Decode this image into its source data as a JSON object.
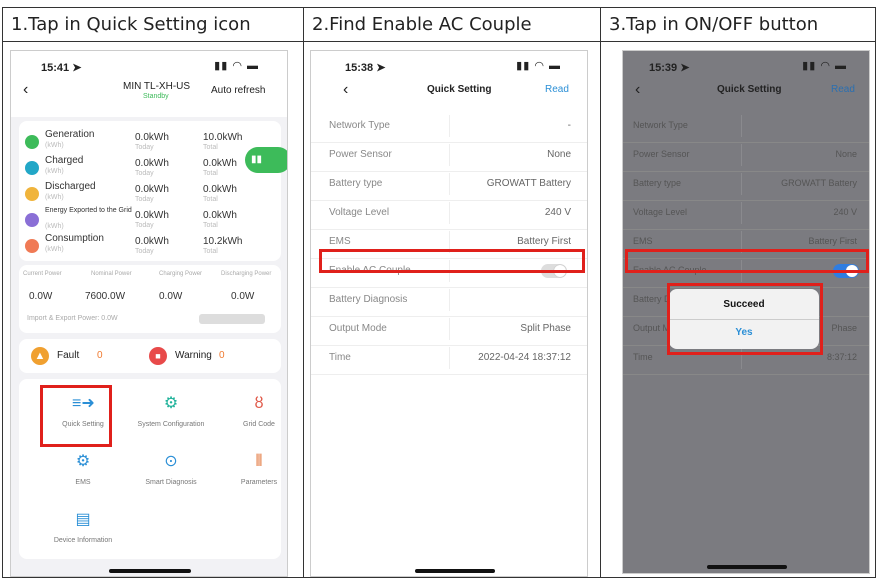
{
  "headers": [
    "1.Tap in Quick Setting icon",
    "2.Find Enable AC Couple",
    "3.Tap in ON/OFF button"
  ],
  "status_icons": "signal-wifi-battery",
  "phone1": {
    "time": "15:41",
    "device": "MIN TL-XH-US",
    "status": "Standby",
    "auto_refresh": "Auto refresh",
    "energy_rows": [
      {
        "label": "Generation",
        "unit": "(kWh)",
        "today": "0.0kWh",
        "today_sub": "Today",
        "total": "10.0kWh",
        "total_sub": "Total",
        "color": "#3dbb5a"
      },
      {
        "label": "Charged",
        "unit": "(kWh)",
        "today": "0.0kWh",
        "today_sub": "Today",
        "total": "0.0kWh",
        "total_sub": "Total",
        "color": "#22a7c7"
      },
      {
        "label": "Discharged",
        "unit": "(kWh)",
        "today": "0.0kWh",
        "today_sub": "Today",
        "total": "0.0kWh",
        "total_sub": "Total",
        "color": "#f0b43c"
      },
      {
        "label": "Energy Exported to the Grid",
        "unit": "(kWh)",
        "today": "0.0kWh",
        "today_sub": "Today",
        "total": "0.0kWh",
        "total_sub": "Total",
        "color": "#8a6fd6"
      },
      {
        "label": "Consumption",
        "unit": "(kWh)",
        "today": "0.0kWh",
        "today_sub": "Today",
        "total": "10.2kWh",
        "total_sub": "Total",
        "color": "#f07a55"
      }
    ],
    "power_labels": [
      "Current Power",
      "Nominal Power",
      "Charging Power",
      "Discharging Power"
    ],
    "power_values": [
      "0.0W",
      "7600.0W",
      "0.0W",
      "0.0W"
    ],
    "import_export": "Import & Export Power: 0.0W",
    "fault_label": "Fault",
    "fault_count": "0",
    "warning_label": "Warning",
    "warning_count": "0",
    "grid_items": [
      {
        "label": "Quick Setting",
        "icon": "quick-setting-icon",
        "glyph": "≡➜",
        "color": "#2b8fd6"
      },
      {
        "label": "System Configuration",
        "icon": "system-configuration-icon",
        "glyph": "⚙",
        "color": "#1fb29a"
      },
      {
        "label": "Grid Code",
        "icon": "grid-code-icon",
        "glyph": "ȣ",
        "color": "#e05a4a"
      },
      {
        "label": "EMS",
        "icon": "ems-icon",
        "glyph": "⚙",
        "color": "#2b8fd6"
      },
      {
        "label": "Smart Diagnosis",
        "icon": "smart-diagnosis-icon",
        "glyph": "⊙",
        "color": "#2b8fd6"
      },
      {
        "label": "Parameters",
        "icon": "parameters-icon",
        "glyph": "⫴",
        "color": "#e06a2a"
      },
      {
        "label": "Device Information",
        "icon": "device-information-icon",
        "glyph": "▤",
        "color": "#2b8fd6"
      }
    ]
  },
  "phone2": {
    "time": "15:38",
    "title": "Quick Setting",
    "read": "Read",
    "rows": [
      {
        "label": "Network Type",
        "value": "-"
      },
      {
        "label": "Power Sensor",
        "value": "None"
      },
      {
        "label": "Battery type",
        "value": "GROWATT Battery"
      },
      {
        "label": "Voltage Level",
        "value": "240 V"
      },
      {
        "label": "EMS",
        "value": "Battery First"
      },
      {
        "label": "Enable AC Couple",
        "value": ""
      },
      {
        "label": "Battery Diagnosis",
        "value": ""
      },
      {
        "label": "Output Mode",
        "value": "Split Phase"
      },
      {
        "label": "Time",
        "value": "2022-04-24 18:37:12"
      }
    ],
    "ac_couple_on": false
  },
  "phone3": {
    "time": "15:39",
    "title": "Quick Setting",
    "read": "Read",
    "rows": [
      {
        "label": "Network Type",
        "value": ""
      },
      {
        "label": "Power Sensor",
        "value": "None"
      },
      {
        "label": "Battery type",
        "value": "GROWATT Battery"
      },
      {
        "label": "Voltage Level",
        "value": "240 V"
      },
      {
        "label": "EMS",
        "value": "Battery First"
      },
      {
        "label": "Enable AC Couple",
        "value": ""
      },
      {
        "label": "Battery D",
        "value": ""
      },
      {
        "label": "Output M",
        "value": "Phase"
      },
      {
        "label": "Time",
        "value": "8:37:12"
      }
    ],
    "ac_couple_on": true,
    "dialog": {
      "title": "Succeed",
      "button": "Yes"
    }
  },
  "colors": {
    "highlight": "#e0201b",
    "link": "#2b8fd6",
    "toggle_on": "#2f7de1"
  }
}
